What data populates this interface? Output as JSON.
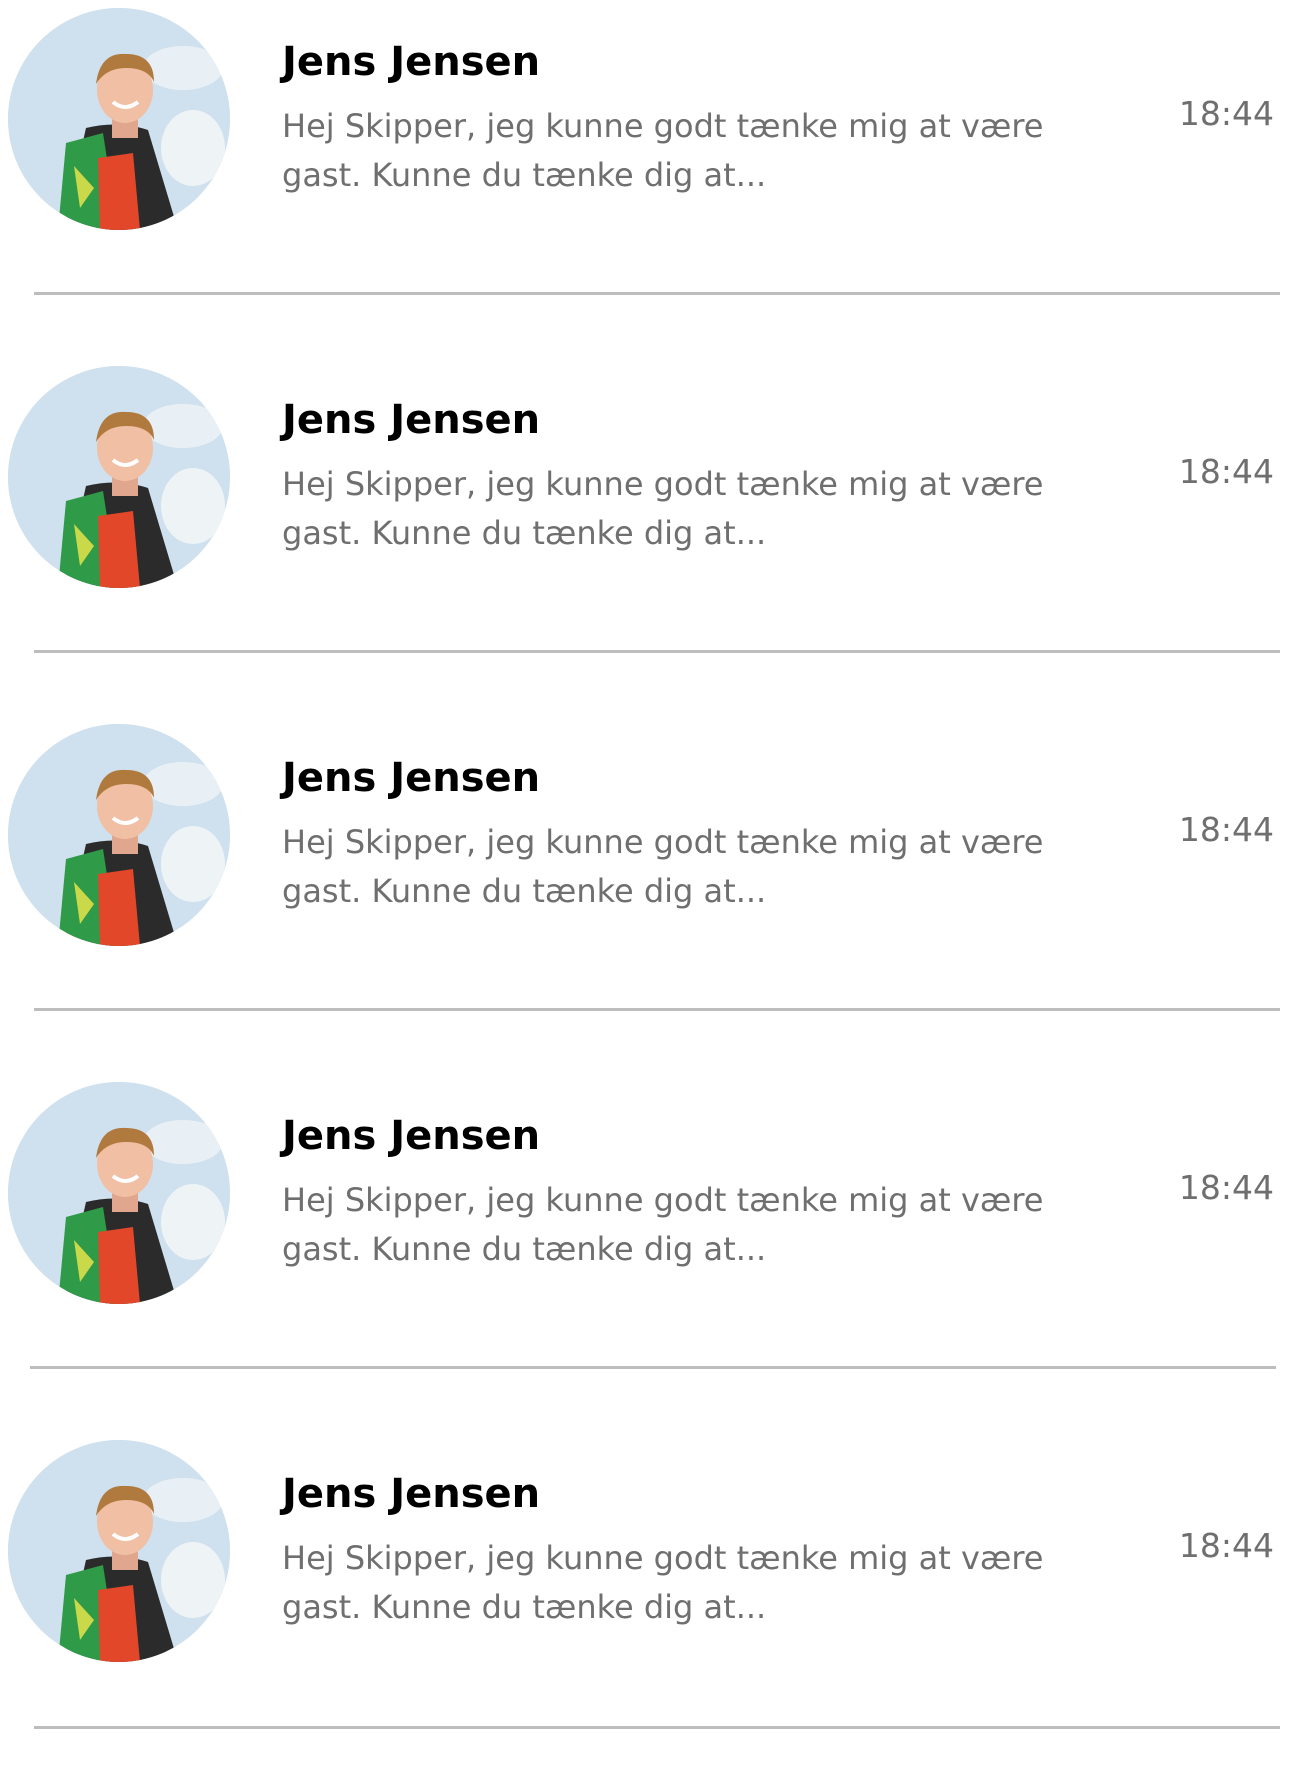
{
  "conversations": [
    {
      "name": "Jens Jensen",
      "preview": "Hej Skipper, jeg kunne godt tænke mig at være gast. Kunne du tænke dig at...",
      "time": "18:44",
      "avatar_icon": "user-photo-avatar"
    },
    {
      "name": "Jens Jensen",
      "preview": "Hej Skipper, jeg kunne godt tænke mig at være gast. Kunne du tænke dig at...",
      "time": "18:44",
      "avatar_icon": "user-photo-avatar"
    },
    {
      "name": "Jens Jensen",
      "preview": "Hej Skipper, jeg kunne godt tænke mig at være gast. Kunne du tænke dig at...",
      "time": "18:44",
      "avatar_icon": "user-photo-avatar"
    },
    {
      "name": "Jens Jensen",
      "preview": "Hej Skipper, jeg kunne godt tænke mig at være gast. Kunne du tænke dig at...",
      "time": "18:44",
      "avatar_icon": "user-photo-avatar"
    },
    {
      "name": "Jens Jensen",
      "preview": "Hej Skipper, jeg kunne godt tænke mig at være gast. Kunne du tænke dig at...",
      "time": "18:44",
      "avatar_icon": "user-photo-avatar"
    }
  ],
  "colors": {
    "name_text": "#000000",
    "secondary_text": "#6f6f6f",
    "divider": "#bdbdbd",
    "background": "#ffffff"
  }
}
